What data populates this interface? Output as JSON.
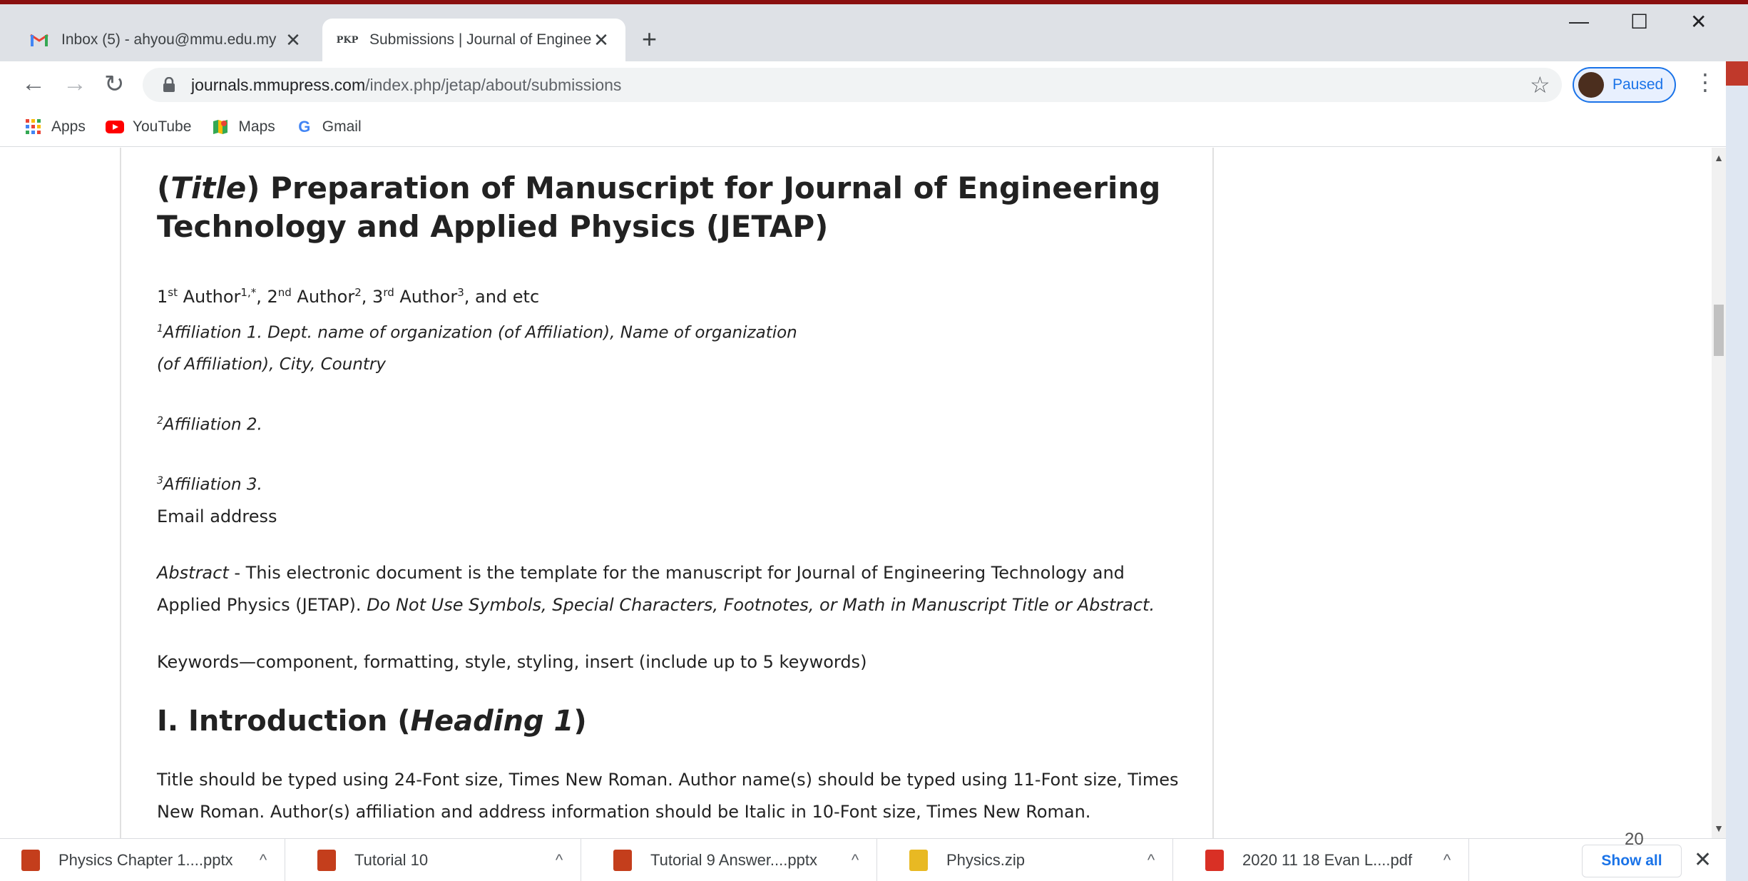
{
  "tabs": [
    {
      "title": "Inbox (5) - ahyou@mmu.edu.my",
      "active": false,
      "icon": "gmail-icon"
    },
    {
      "title": "Submissions | Journal of Enginee",
      "active": true,
      "icon": "pkp-icon",
      "favicon_text": "PKP"
    }
  ],
  "toolbar": {
    "url_host": "journals.mmupress.com",
    "url_path": "/index.php/jetap/about/submissions",
    "profile_label": "Paused"
  },
  "bookmarks": [
    {
      "label": "Apps",
      "icon": "apps-grid-icon"
    },
    {
      "label": "YouTube",
      "icon": "youtube-icon"
    },
    {
      "label": "Maps",
      "icon": "maps-icon"
    },
    {
      "label": "Gmail",
      "icon": "google-g-icon"
    }
  ],
  "article": {
    "title_paren_open": "(",
    "title_italic": "Title",
    "title_rest_line1": ") Preparation of Manuscript for Journal of Engineering",
    "title_line2": "Technology and Applied Physics (JETAP)",
    "authors": {
      "a1_num": "1",
      "a1_sup": "st",
      "a1_name": " Author",
      "a1_aff": "1,*",
      "a2_num": ", 2",
      "a2_sup": "nd",
      "a2_name": " Author",
      "a2_aff": "2",
      "a3_num": ", 3",
      "a3_sup": "rd",
      "a3_name": " Author",
      "a3_aff": "3",
      "tail": ", and etc"
    },
    "aff1_sup": "1",
    "aff1_line1": "Affiliation 1. Dept. name of organization (of Affiliation), Name of organization",
    "aff1_line2": "(of Affiliation), City, Country",
    "aff2_sup": "2",
    "aff2": "Affiliation 2.",
    "aff3_sup": "3",
    "aff3": "Affiliation 3.",
    "email": "Email address",
    "abstract_label": "Abstract",
    "abstract_text": " - This electronic document is the template for the manuscript for Journal of Engineering Technology and Applied Physics (JETAP). ",
    "abstract_note": "Do Not Use Symbols, Special Characters, Footnotes, or Math in Manuscript Title or Abstract.",
    "keywords": "Keywords—component, formatting, style, styling, insert (include up to 5 keywords)",
    "heading1_prefix": "I. Introduction (",
    "heading1_italic": "Heading 1",
    "heading1_suffix": ")",
    "body_text": "Title should be typed using 24-Font size, Times New Roman. Author name(s) should be typed using 11-Font size, Times New Roman. Author(s) affiliation and address information should be Italic in 10-Font size, Times New Roman."
  },
  "downloads": [
    {
      "name": "Physics Chapter 1....pptx",
      "icon": "powerpoint-icon",
      "color": "#c43e1c"
    },
    {
      "name": "Tutorial 10",
      "icon": "powerpoint-icon",
      "color": "#c43e1c"
    },
    {
      "name": "Tutorial 9 Answer....pptx",
      "icon": "powerpoint-icon",
      "color": "#c43e1c"
    },
    {
      "name": "Physics.zip",
      "icon": "zip-icon",
      "color": "#e8b923"
    },
    {
      "name": "2020 11 18 Evan L....pdf",
      "icon": "pdf-icon",
      "color": "#d93025"
    }
  ],
  "downloads_show_all": "Show all",
  "slide_number": "20",
  "colors": {
    "accent": "#1a73e8",
    "tab_bar": "#dee1e6"
  }
}
